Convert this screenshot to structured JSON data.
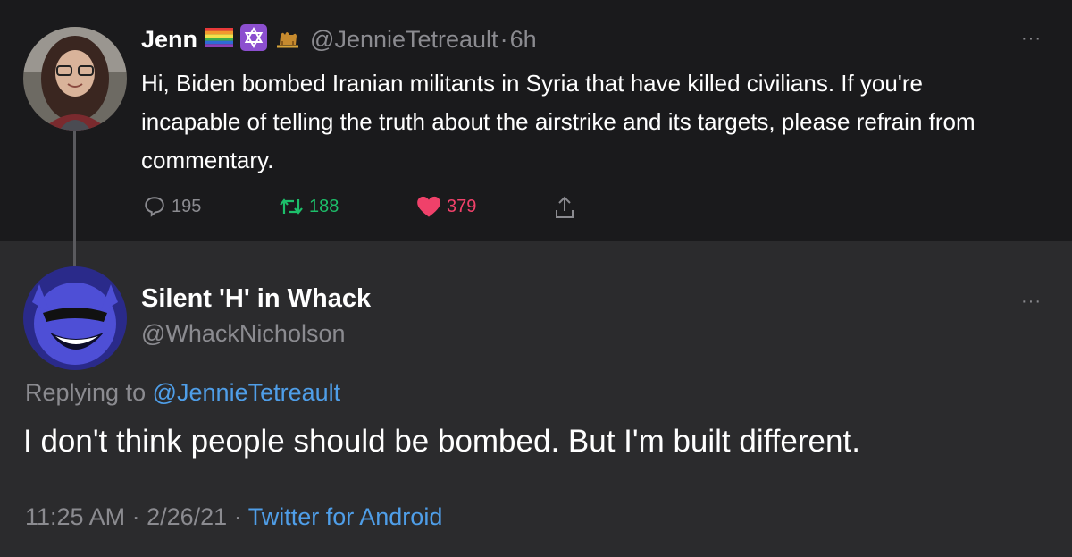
{
  "top_tweet": {
    "display_name": "Jenn",
    "handle": "@JennieTetreault",
    "separator": "·",
    "time": "6h",
    "text": "Hi, Biden bombed Iranian militants in Syria that have killed civilians. If you're incapable of telling the truth about the airstrike and its targets, please refrain from commentary.",
    "flair_icons": [
      "rainbow-flag-icon",
      "star-of-david-icon",
      "camel-icon"
    ],
    "reply_count": "195",
    "retweet_count": "188",
    "like_count": "379",
    "more_label": "···"
  },
  "reply_tweet": {
    "display_name": "Silent 'H' in Whack",
    "handle": "@WhackNicholson",
    "replying_prefix": "Replying to",
    "replying_to": "@JennieTetreault",
    "text": "I don't think people should be bombed. But I'm built different.",
    "time": "11:25 AM",
    "date": "2/26/21",
    "separator": "·",
    "source": "Twitter for Android",
    "more_label": "···"
  },
  "colors": {
    "retweet_green": "#1dbf6a",
    "like_pink": "#f0416a",
    "link_blue": "#4f9ee8",
    "muted_gray": "#8b8b90"
  }
}
